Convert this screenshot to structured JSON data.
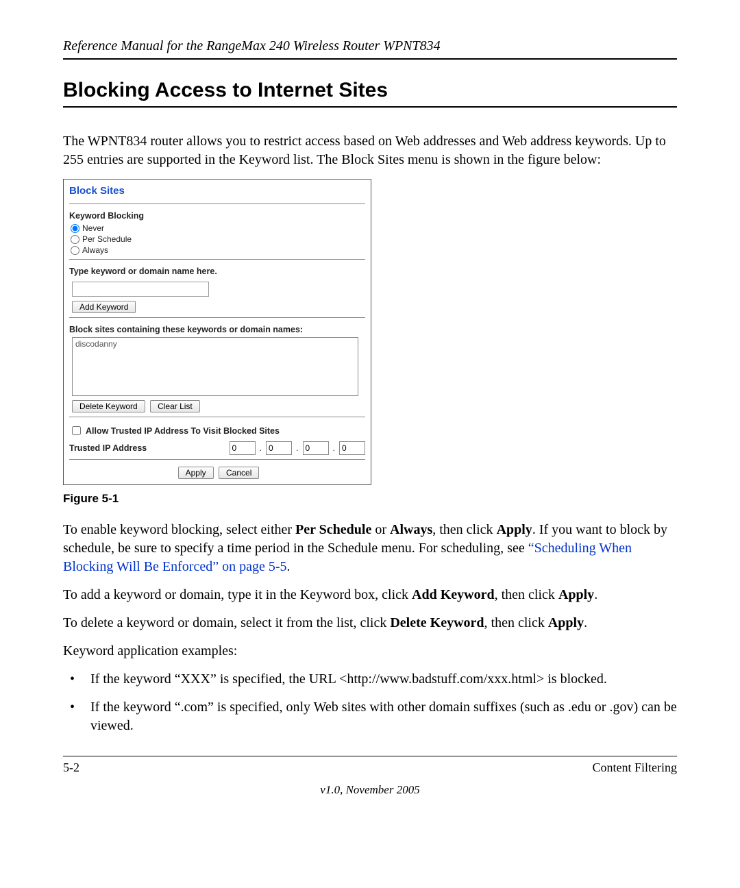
{
  "running_head": "Reference Manual for the RangeMax 240 Wireless Router WPNT834",
  "section_title": "Blocking Access to Internet Sites",
  "intro_paragraph": "The WPNT834 router allows you to restrict access based on Web addresses and Web address keywords. Up to 255 entries are supported in the Keyword list. The Block Sites menu is shown in the figure below:",
  "figure": {
    "caption": "Figure 5-1",
    "panel_title": "Block Sites",
    "keyword_blocking_label": "Keyword Blocking",
    "radios": {
      "never": "Never",
      "per_schedule": "Per Schedule",
      "always": "Always"
    },
    "type_label": "Type keyword or domain name here.",
    "add_keyword_btn": "Add Keyword",
    "list_label": "Block sites containing these keywords or domain names:",
    "list_item": "discodanny",
    "delete_keyword_btn": "Delete Keyword",
    "clear_list_btn": "Clear List",
    "allow_trusted_label": "Allow Trusted IP Address To Visit Blocked Sites",
    "trusted_ip_label": "Trusted IP Address",
    "ip": [
      "0",
      "0",
      "0",
      "0"
    ],
    "apply_btn": "Apply",
    "cancel_btn": "Cancel"
  },
  "para_enable": {
    "pre": "To enable keyword blocking, select either ",
    "b1": "Per Schedule",
    "mid1": " or ",
    "b2": "Always",
    "mid2": ", then click ",
    "b3": "Apply",
    "post": ". If you want to block by schedule, be sure to specify a time period in the Schedule menu. For scheduling, see ",
    "xref": "“Scheduling When Blocking Will Be Enforced” on page 5-5",
    "tail": "."
  },
  "para_add": {
    "pre": "To add a keyword or domain, type it in the Keyword box, click ",
    "b1": "Add Keyword",
    "mid": ", then click ",
    "b2": "Apply",
    "tail": "."
  },
  "para_delete": {
    "pre": "To delete a keyword or domain, select it from the list, click ",
    "b1": "Delete Keyword",
    "mid": ", then click ",
    "b2": "Apply",
    "tail": "."
  },
  "examples_intro": "Keyword application examples:",
  "bullets": [
    "If the keyword “XXX” is specified, the URL <http://www.badstuff.com/xxx.html> is blocked.",
    "If the keyword “.com” is specified, only Web sites with other domain suffixes (such as .edu or .gov) can be viewed."
  ],
  "footer": {
    "left": "5-2",
    "right": "Content Filtering",
    "version": "v1.0, November 2005"
  }
}
